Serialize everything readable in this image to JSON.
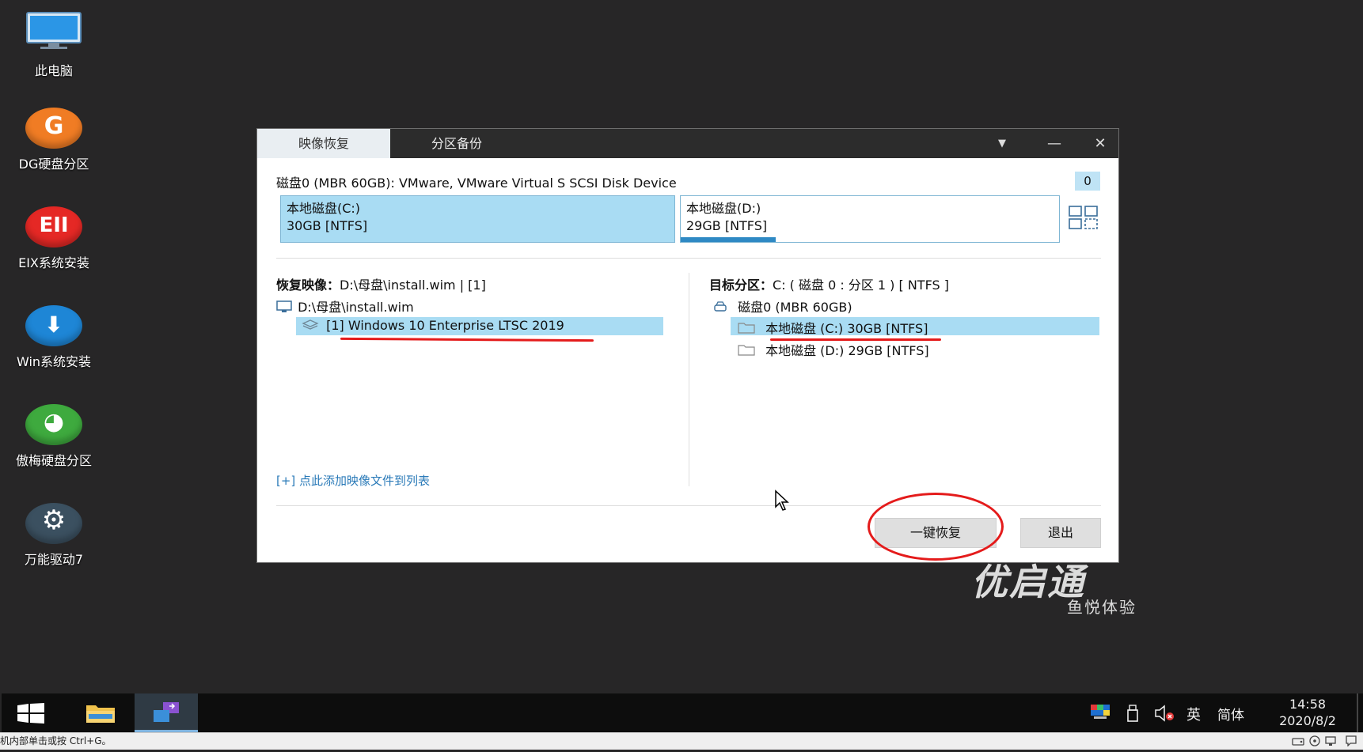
{
  "desktop_icons": [
    {
      "label": "此电脑",
      "icon": "monitor-icon"
    },
    {
      "label": "DG硬盘分区",
      "icon": "dg-disk-icon",
      "glyph": "G",
      "color": "#f07c24"
    },
    {
      "label": "EIX系统安装",
      "icon": "eix-install-icon",
      "glyph": "EII",
      "color": "#e52825"
    },
    {
      "label": "Win系统安装",
      "icon": "win-install-icon",
      "glyph": "⬇",
      "color": "#1e86d6"
    },
    {
      "label": "傲梅硬盘分区",
      "icon": "aomei-partition-icon",
      "glyph": "◕",
      "color": "#3eaa3e"
    },
    {
      "label": "万能驱动7",
      "icon": "driver-gear-icon",
      "glyph": "⚙",
      "color": "#3b5060"
    }
  ],
  "dialog": {
    "tabs": [
      "映像恢复",
      "分区备份"
    ],
    "controls": {
      "dropdown": "▼",
      "minimize": "—",
      "close": "✕"
    },
    "disk_header": "磁盘0 (MBR 60GB): VMware, VMware Virtual S SCSI Disk Device",
    "disk_index": "0",
    "partitions": [
      {
        "name": "本地磁盘(C:)",
        "info": "30GB [NTFS]",
        "selected": true
      },
      {
        "name": "本地磁盘(D:)",
        "info": "29GB [NTFS]",
        "selected": false,
        "usage": 0.25
      }
    ],
    "restore_image": {
      "label": "恢复映像：",
      "value": "D:\\母盘\\install.wim | [1]"
    },
    "image_tree": {
      "file": "D:\\母盘\\install.wim",
      "edition": "[1] Windows 10 Enterprise LTSC 2019"
    },
    "add_link": "[+] 点此添加映像文件到列表",
    "target": {
      "label": "目标分区：",
      "value": "C: ( 磁盘 0 : 分区 1 ) [ NTFS ]"
    },
    "target_tree": {
      "disk": "磁盘0 (MBR 60GB)",
      "items": [
        "本地磁盘 (C:) 30GB [NTFS]",
        "本地磁盘 (D:) 29GB [NTFS]"
      ]
    },
    "buttons": {
      "restore": "一键恢复",
      "exit": "退出"
    }
  },
  "watermark": {
    "title": "优启通",
    "subtitle": "鱼悦体验"
  },
  "taskbar": {
    "ime_lang": "英",
    "ime_mode": "简体",
    "time": "14:58",
    "date": "2020/8/2"
  },
  "statusbar": {
    "hint": "机内部单击或按 Ctrl+G。"
  },
  "colors": {
    "desktop": "#272627",
    "titlebar": "#2c2c2c",
    "selection": "#a9dcf3",
    "accent_blue": "#0a78c8",
    "annotation_red": "#e41b1b"
  }
}
